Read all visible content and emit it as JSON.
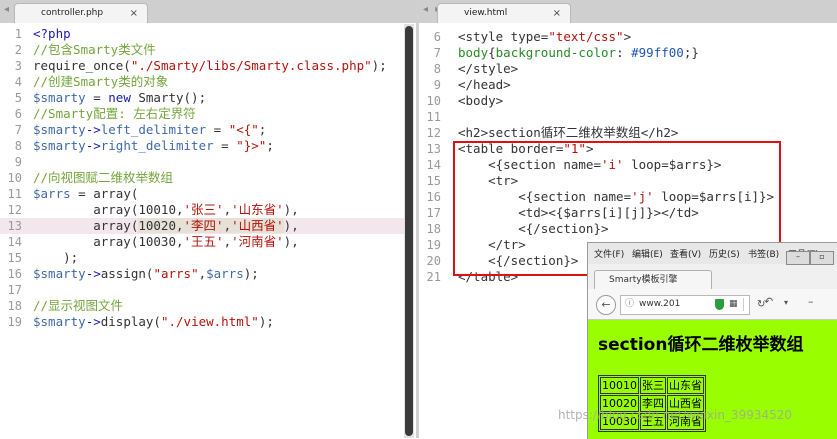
{
  "left_tab": {
    "title": "controller.php",
    "close": "×"
  },
  "right_tab": {
    "title": "view.html",
    "close": "×",
    "nav": "◂▸"
  },
  "left_code": [
    {
      "n": "1",
      "parts": [
        [
          "c-kw",
          "<?php"
        ]
      ]
    },
    {
      "n": "2",
      "parts": [
        [
          "c-comment",
          "//包含Smarty类文件"
        ]
      ]
    },
    {
      "n": "3",
      "parts": [
        [
          "c-fn",
          "require_once("
        ],
        [
          "c-str",
          "\"./Smarty/libs/Smarty.class.php\""
        ],
        [
          "c-fn",
          ");"
        ]
      ]
    },
    {
      "n": "4",
      "parts": [
        [
          "c-comment",
          "//创建Smarty类的对象"
        ]
      ]
    },
    {
      "n": "5",
      "parts": [
        [
          "c-var",
          "$smarty"
        ],
        [
          "c-fn",
          " = "
        ],
        [
          "c-kw",
          "new"
        ],
        [
          "c-fn",
          " Smarty();"
        ]
      ]
    },
    {
      "n": "6",
      "parts": [
        [
          "c-comment",
          "//Smarty配置: 左右定界符"
        ]
      ]
    },
    {
      "n": "7",
      "parts": [
        [
          "c-var",
          "$smarty"
        ],
        [
          "c-kw",
          "->"
        ],
        [
          "c-var",
          "left_delimiter"
        ],
        [
          "c-fn",
          " = "
        ],
        [
          "c-str",
          "\"<{\""
        ],
        [
          "c-fn",
          ";"
        ]
      ]
    },
    {
      "n": "8",
      "parts": [
        [
          "c-var",
          "$smarty"
        ],
        [
          "c-kw",
          "->"
        ],
        [
          "c-var",
          "right_delimiter"
        ],
        [
          "c-fn",
          " = "
        ],
        [
          "c-str",
          "\"}>\""
        ],
        [
          "c-fn",
          ";"
        ]
      ]
    },
    {
      "n": "9",
      "parts": []
    },
    {
      "n": "10",
      "parts": [
        [
          "c-comment",
          "//向视图赋二维枚举数组"
        ]
      ]
    },
    {
      "n": "11",
      "parts": [
        [
          "c-var",
          "$arrs"
        ],
        [
          "c-fn",
          " = array("
        ]
      ]
    },
    {
      "n": "12",
      "parts": [
        [
          "c-fn",
          "        array(10010,"
        ],
        [
          "c-str",
          "'张三'"
        ],
        [
          "c-fn",
          ","
        ],
        [
          "c-str",
          "'山东省'"
        ],
        [
          "c-fn",
          "),"
        ]
      ]
    },
    {
      "n": "13",
      "parts": [
        [
          "c-fn",
          "        array("
        ],
        [
          "sel c-fn",
          "10020,"
        ],
        [
          "sel c-str",
          "'李四'"
        ],
        [
          "sel c-fn",
          ","
        ],
        [
          "sel c-str",
          "'山西省'"
        ],
        [
          "c-fn",
          "),"
        ]
      ],
      "hl": true
    },
    {
      "n": "14",
      "parts": [
        [
          "c-fn",
          "        array(10030,"
        ],
        [
          "c-str",
          "'王五'"
        ],
        [
          "c-fn",
          ","
        ],
        [
          "c-str",
          "'河南省'"
        ],
        [
          "c-fn",
          "),"
        ]
      ]
    },
    {
      "n": "15",
      "parts": [
        [
          "c-fn",
          "    );"
        ]
      ]
    },
    {
      "n": "16",
      "parts": [
        [
          "c-var",
          "$smarty"
        ],
        [
          "c-kw",
          "->"
        ],
        [
          "c-fn",
          "assign("
        ],
        [
          "c-str",
          "\"arrs\""
        ],
        [
          "c-fn",
          ","
        ],
        [
          "c-var",
          "$arrs"
        ],
        [
          "c-fn",
          ");"
        ]
      ]
    },
    {
      "n": "17",
      "parts": []
    },
    {
      "n": "18",
      "parts": [
        [
          "c-comment",
          "//显示视图文件"
        ]
      ]
    },
    {
      "n": "19",
      "parts": [
        [
          "c-var",
          "$smarty"
        ],
        [
          "c-kw",
          "->"
        ],
        [
          "c-fn",
          "display("
        ],
        [
          "c-str",
          "\"./view.html\""
        ],
        [
          "c-fn",
          ");"
        ]
      ]
    }
  ],
  "right_code": [
    {
      "n": "6",
      "parts": [
        [
          "c-tag",
          "<style type="
        ],
        [
          "c-str",
          "\"text/css\""
        ],
        [
          "c-tag",
          ">"
        ]
      ]
    },
    {
      "n": "7",
      "parts": [
        [
          "c-prop",
          "body"
        ],
        [
          "c-fn",
          "{"
        ],
        [
          "c-prop",
          "background-color"
        ],
        [
          "c-fn",
          ": "
        ],
        [
          "c-hex",
          "#99ff00"
        ],
        [
          "c-fn",
          ";}"
        ]
      ]
    },
    {
      "n": "8",
      "parts": [
        [
          "c-tag",
          "</style>"
        ]
      ]
    },
    {
      "n": "9",
      "parts": [
        [
          "c-tag",
          "</head>"
        ]
      ]
    },
    {
      "n": "10",
      "parts": [
        [
          "c-tag",
          "<body>"
        ]
      ]
    },
    {
      "n": "11",
      "parts": []
    },
    {
      "n": "12",
      "parts": [
        [
          "c-tag",
          "<h2>section循环二维枚举数组</h2>"
        ]
      ]
    },
    {
      "n": "13",
      "parts": [
        [
          "c-tag",
          "<table border="
        ],
        [
          "c-str",
          "\"1\""
        ],
        [
          "c-tag",
          ">"
        ]
      ]
    },
    {
      "n": "14",
      "parts": [
        [
          "c-fn",
          "    <{section name="
        ],
        [
          "c-str",
          "'i'"
        ],
        [
          "c-fn",
          " loop=$arrs}>"
        ]
      ]
    },
    {
      "n": "15",
      "parts": [
        [
          "c-tag",
          "    <tr>"
        ]
      ]
    },
    {
      "n": "16",
      "parts": [
        [
          "c-fn",
          "        <{section name="
        ],
        [
          "c-str",
          "'j'"
        ],
        [
          "c-fn",
          " loop=$arrs[i]}>"
        ]
      ]
    },
    {
      "n": "17",
      "parts": [
        [
          "c-tag",
          "        <td>"
        ],
        [
          "c-fn",
          "<{$arrs[i][j]}>"
        ],
        [
          "c-tag",
          "</td>"
        ]
      ]
    },
    {
      "n": "18",
      "parts": [
        [
          "c-fn",
          "        <{/section}>"
        ]
      ]
    },
    {
      "n": "19",
      "parts": [
        [
          "c-tag",
          "    </tr>"
        ]
      ]
    },
    {
      "n": "20",
      "parts": [
        [
          "c-fn",
          "    <{/section}>"
        ]
      ]
    },
    {
      "n": "21",
      "parts": [
        [
          "c-tag",
          "</table>"
        ]
      ]
    }
  ],
  "browser": {
    "menu": [
      "文件(F)",
      "编辑(E)",
      "查看(V)",
      "历史(S)",
      "书签(B)",
      "工具(T)"
    ],
    "tab_title": "Smarty模板引擎",
    "url": "www.201",
    "page_heading": "section循环二维枚举数组",
    "table": [
      [
        "10010",
        "张三",
        "山东省"
      ],
      [
        "10020",
        "李四",
        "山西省"
      ],
      [
        "10030",
        "王五",
        "河南省"
      ]
    ]
  },
  "watermark": "https://blog.csdn.net/weixin_39934520",
  "colors": {
    "page_bg": "#99ff00",
    "highlight_box": "#e01010"
  }
}
